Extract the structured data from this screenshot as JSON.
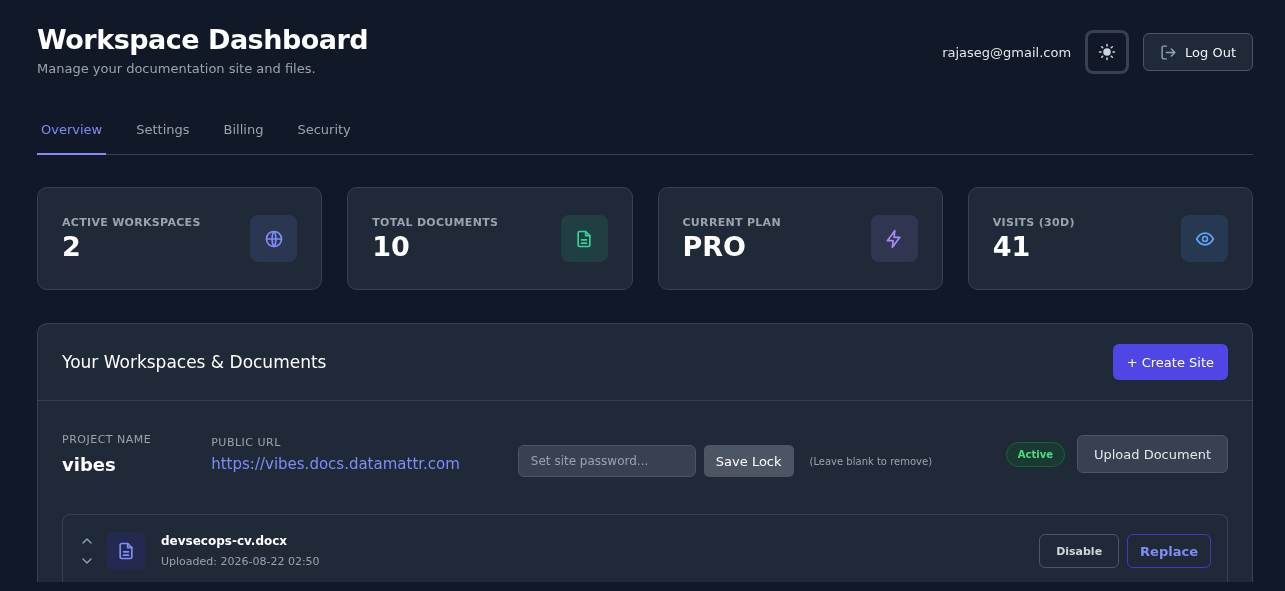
{
  "header": {
    "title": "Workspace Dashboard",
    "subtitle": "Manage your documentation site and files.",
    "user_email": "rajaseg@gmail.com",
    "theme_toggle": {
      "focused": true
    },
    "logout_label": "Log Out"
  },
  "tabs": [
    {
      "label": "Overview",
      "selected": true
    },
    {
      "label": "Settings",
      "selected": false
    },
    {
      "label": "Billing",
      "selected": false
    },
    {
      "label": "Security",
      "selected": false
    }
  ],
  "stats": [
    {
      "label": "ACTIVE WORKSPACES",
      "value": "2",
      "kind": "globe",
      "color": "#818cf8"
    },
    {
      "label": "TOTAL DOCUMENTS",
      "value": "10",
      "kind": "file",
      "color": "#34d399"
    },
    {
      "label": "CURRENT PLAN",
      "value": "PRO",
      "kind": "bolt",
      "color": "#a78bfa"
    },
    {
      "label": "VISITS (30D)",
      "value": "41",
      "kind": "eye",
      "color": "#60a5fa"
    }
  ],
  "panel": {
    "title": "Your Workspaces & Documents",
    "create_label": "+ Create Site",
    "project": {
      "name_label": "PROJECT NAME",
      "name": "vibes",
      "url_label": "PUBLIC URL",
      "url": "https://vibes.docs.datamattr.com",
      "password": {
        "placeholder": "Set site password..."
      },
      "save_label": "Save Lock",
      "hint": "(Leave blank to remove)",
      "active": true,
      "status_label": "Active",
      "upload_label": "Upload Document",
      "documents": [
        {
          "name": "devsecops-cv.docx",
          "uploaded": "Uploaded: 2026-08-22 02:50",
          "disable_label": "Disable",
          "replace_label": "Replace"
        }
      ]
    }
  }
}
